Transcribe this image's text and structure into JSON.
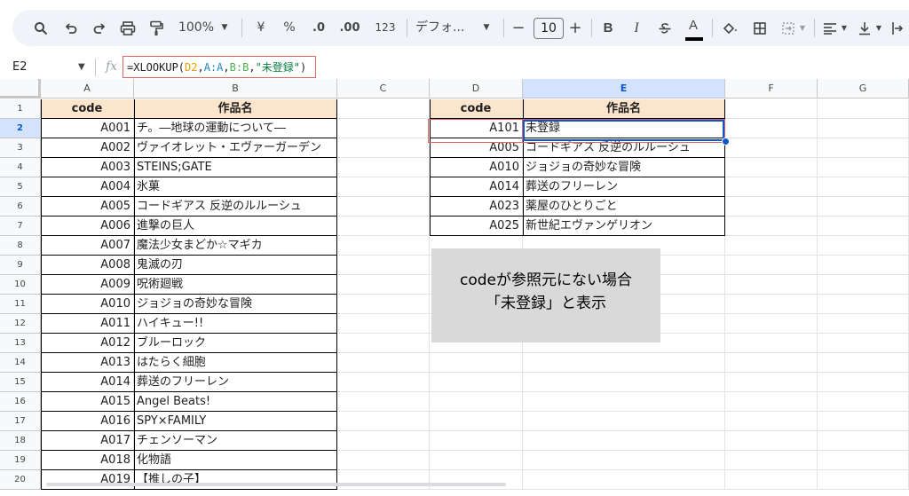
{
  "toolbar": {
    "zoom": "100%",
    "currency": "¥",
    "percent": "%",
    "dec_decrease": ".0",
    "dec_increase": ".00",
    "number_format": "123",
    "font": "デフォ...",
    "font_size": "10",
    "bold": "B",
    "italic": "I",
    "text_color": "A"
  },
  "formula_bar": {
    "cell_ref": "E2",
    "fx": "fx",
    "formula_parts": [
      "=XLOOKUP(",
      "D2",
      ",",
      "A:A",
      ",",
      "B:B",
      ",",
      "\"未登録\"",
      ")"
    ]
  },
  "columns": [
    "A",
    "B",
    "C",
    "D",
    "E",
    "F",
    "G"
  ],
  "rows": [
    "1",
    "2",
    "3",
    "4",
    "5",
    "6",
    "7",
    "8",
    "9",
    "10",
    "11",
    "12",
    "13",
    "14",
    "15",
    "16",
    "17",
    "18",
    "19",
    "20"
  ],
  "left_table": {
    "headers": [
      "code",
      "作品名"
    ],
    "rows": [
      [
        "A001",
        "チ。―地球の運動について―"
      ],
      [
        "A002",
        "ヴァイオレット・エヴァーガーデン"
      ],
      [
        "A003",
        "STEINS;GATE"
      ],
      [
        "A004",
        "氷菓"
      ],
      [
        "A005",
        "コードギアス 反逆のルルーシュ"
      ],
      [
        "A006",
        "進撃の巨人"
      ],
      [
        "A007",
        "魔法少女まどか☆マギカ"
      ],
      [
        "A008",
        "鬼滅の刃"
      ],
      [
        "A009",
        "呪術廻戦"
      ],
      [
        "A010",
        "ジョジョの奇妙な冒険"
      ],
      [
        "A011",
        "ハイキュー!!"
      ],
      [
        "A012",
        "ブルーロック"
      ],
      [
        "A013",
        "はたらく細胞"
      ],
      [
        "A014",
        "葬送のフリーレン"
      ],
      [
        "A015",
        "Angel Beats!"
      ],
      [
        "A016",
        "SPY×FAMILY"
      ],
      [
        "A017",
        "チェンソーマン"
      ],
      [
        "A018",
        "化物語"
      ],
      [
        "A019",
        "【推しの子】"
      ]
    ]
  },
  "right_table": {
    "headers": [
      "code",
      "作品名"
    ],
    "rows": [
      [
        "A101",
        "未登録"
      ],
      [
        "A005",
        "コードギアス 反逆のルルーシュ"
      ],
      [
        "A010",
        "ジョジョの奇妙な冒険"
      ],
      [
        "A014",
        "葬送のフリーレン"
      ],
      [
        "A023",
        "薬屋のひとりごと"
      ],
      [
        "A025",
        "新世紀エヴァンゲリオン"
      ]
    ]
  },
  "note": {
    "line1": "codeが参照元にない場合",
    "line2": "「未登録」と表示"
  }
}
